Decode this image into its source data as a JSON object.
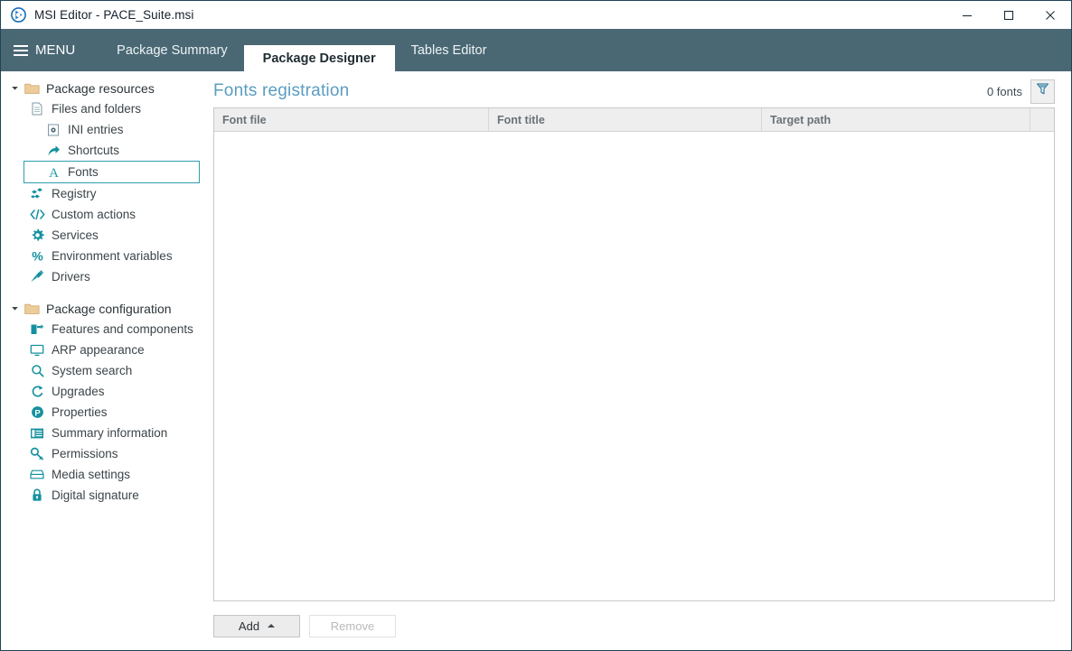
{
  "window": {
    "title": "MSI Editor - PACE_Suite.msi",
    "app_icon": "pace-suite-logo-icon",
    "controls": [
      {
        "name": "minimize-button",
        "glyph": "minimize-icon"
      },
      {
        "name": "maximize-button",
        "glyph": "maximize-icon"
      },
      {
        "name": "close-button",
        "glyph": "close-icon"
      }
    ]
  },
  "topbar": {
    "menu_label": "MENU",
    "menu_icon": "hamburger-icon",
    "tabs": [
      {
        "label": "Package Summary",
        "active": false
      },
      {
        "label": "Package Designer",
        "active": true
      },
      {
        "label": "Tables Editor",
        "active": false
      }
    ]
  },
  "sidebar": {
    "groups": [
      {
        "label": "Package resources",
        "icon": "folder-open-icon",
        "expanded": true,
        "items": [
          {
            "label": "Files and folders",
            "icon": "document-icon",
            "level": 1,
            "selected": false
          },
          {
            "label": "INI entries",
            "icon": "ini-file-icon",
            "level": 2,
            "selected": false
          },
          {
            "label": "Shortcuts",
            "icon": "shortcut-arrow-icon",
            "level": 2,
            "selected": false
          },
          {
            "label": "Fonts",
            "icon": "font-letter-a-icon",
            "level": 2,
            "selected": true
          },
          {
            "label": "Registry",
            "icon": "registry-blocks-icon",
            "level": 1,
            "selected": false
          },
          {
            "label": "Custom actions",
            "icon": "code-brackets-icon",
            "level": 1,
            "selected": false
          },
          {
            "label": "Services",
            "icon": "gear-icon",
            "level": 1,
            "selected": false
          },
          {
            "label": "Environment variables",
            "icon": "percent-icon",
            "level": 1,
            "selected": false
          },
          {
            "label": "Drivers",
            "icon": "plug-icon",
            "level": 1,
            "selected": false
          }
        ]
      },
      {
        "label": "Package configuration",
        "icon": "folder-open-icon",
        "expanded": true,
        "items": [
          {
            "label": "Features and components",
            "icon": "features-icon",
            "level": 1,
            "selected": false
          },
          {
            "label": "ARP appearance",
            "icon": "monitor-icon",
            "level": 1,
            "selected": false
          },
          {
            "label": "System search",
            "icon": "search-icon",
            "level": 1,
            "selected": false
          },
          {
            "label": "Upgrades",
            "icon": "refresh-icon",
            "level": 1,
            "selected": false
          },
          {
            "label": "Properties",
            "icon": "letter-p-circle-icon",
            "level": 1,
            "selected": false
          },
          {
            "label": "Summary information",
            "icon": "list-panel-icon",
            "level": 1,
            "selected": false
          },
          {
            "label": "Permissions",
            "icon": "key-icon",
            "level": 1,
            "selected": false
          },
          {
            "label": "Media settings",
            "icon": "disk-drive-icon",
            "level": 1,
            "selected": false
          },
          {
            "label": "Digital signature",
            "icon": "lock-icon",
            "level": 1,
            "selected": false
          }
        ]
      }
    ]
  },
  "main": {
    "title": "Fonts registration",
    "count_label": "0 fonts",
    "filter_icon": "funnel-filter-icon",
    "table": {
      "columns": [
        "Font file",
        "Font title",
        "Target path"
      ],
      "rows": []
    },
    "buttons": {
      "add": "Add",
      "add_caret": "caret-up-icon",
      "remove": "Remove",
      "remove_disabled": true
    }
  },
  "colors": {
    "topbar": "#4a6874",
    "accent_teal": "#1f9aa8",
    "title_blue": "#5b9dc0",
    "window_border": "#1d4456",
    "selection_border": "#2f9fae"
  }
}
